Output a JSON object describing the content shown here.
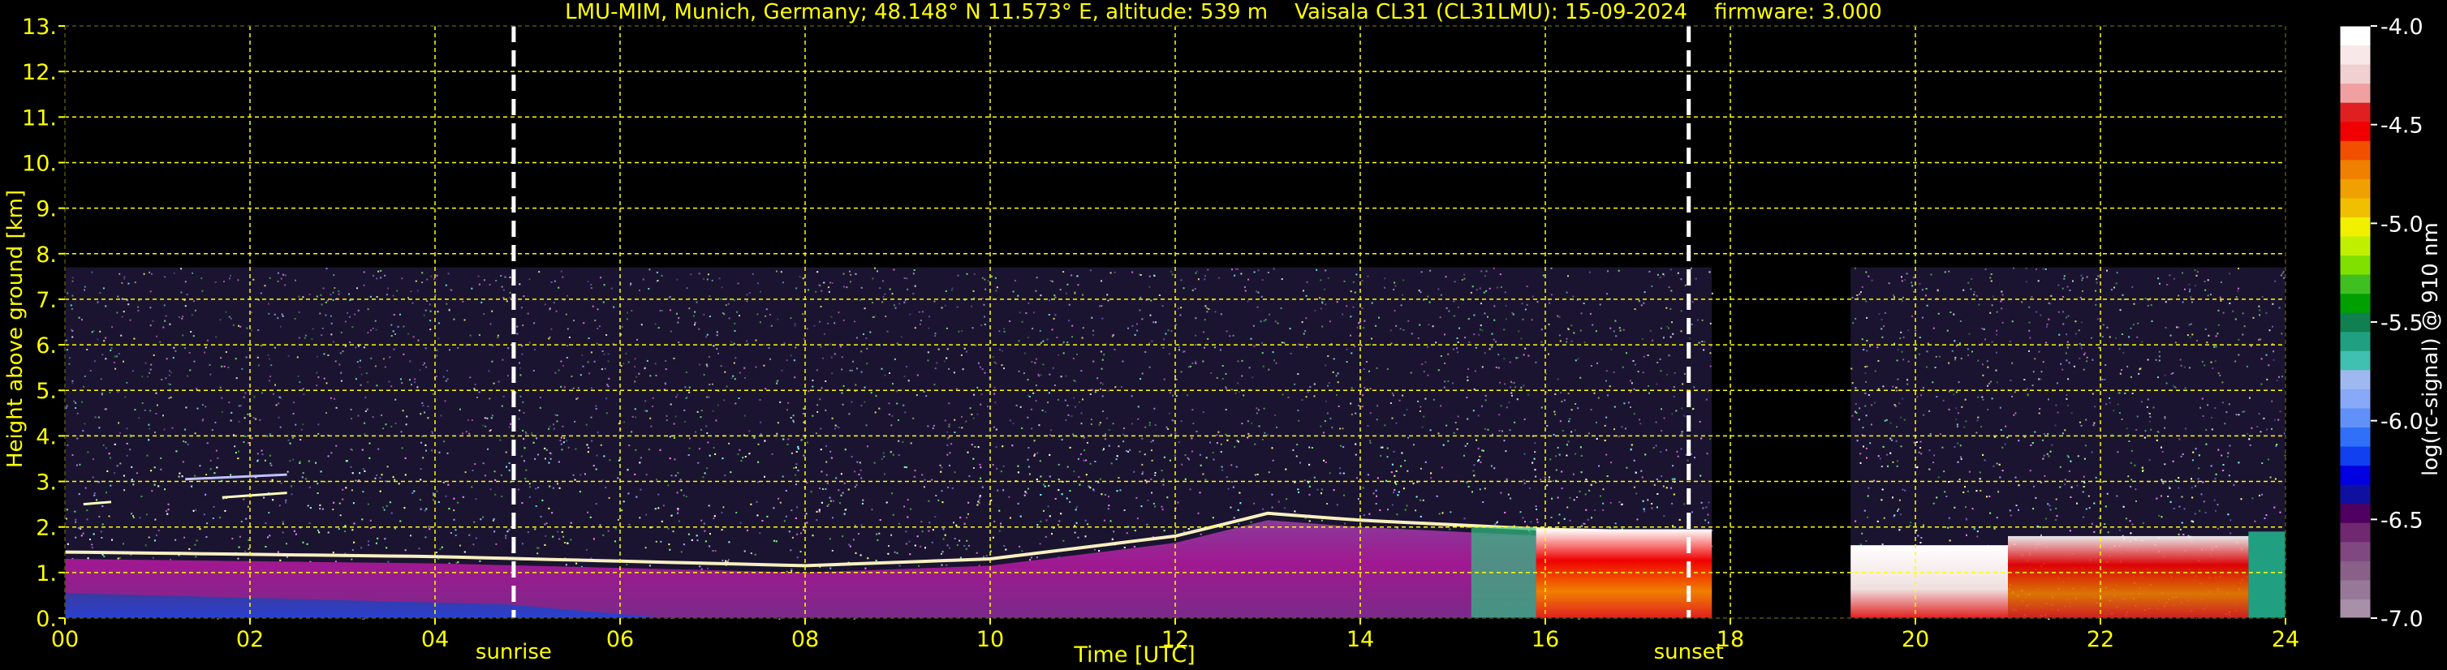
{
  "title": "LMU-MIM, Munich, Germany; 48.148° N 11.573° E, altitude: 539 m    Vaisala CL31 (CL31LMU): 15-09-2024    firmware: 3.000",
  "colors": {
    "axis_text": "#ffff00",
    "grid": "#ffff00",
    "marker_line": "#ffffff",
    "background": "#000000"
  },
  "chart_data": {
    "type": "heatmap",
    "xlabel": "Time [UTC]",
    "ylabel": "Height above ground [km]",
    "xlim": [
      0,
      24
    ],
    "ylim": [
      0,
      13
    ],
    "x_ticks": [
      "00",
      "02",
      "04",
      "06",
      "08",
      "10",
      "12",
      "14",
      "16",
      "18",
      "20",
      "22",
      "24"
    ],
    "y_ticks": [
      "0.",
      "1.",
      "2.",
      "3.",
      "4.",
      "5.",
      "6.",
      "7.",
      "8.",
      "9.",
      "10.",
      "11.",
      "12.",
      "13."
    ],
    "grid": true,
    "annotations": [
      {
        "label": "sunrise",
        "time_h": 4.85
      },
      {
        "label": "sunset",
        "time_h": 17.55
      }
    ],
    "data_gaps_h": [
      [
        17.8,
        19.3
      ]
    ],
    "max_signal_height_km": 7.7,
    "boundary_layer_top_km": [
      [
        0,
        1.45
      ],
      [
        2,
        1.4
      ],
      [
        4,
        1.35
      ],
      [
        6,
        1.25
      ],
      [
        8,
        1.15
      ],
      [
        10,
        1.3
      ],
      [
        12,
        1.8
      ],
      [
        13,
        2.3
      ],
      [
        14,
        2.15
      ],
      [
        15,
        2.05
      ],
      [
        16,
        1.95
      ],
      [
        17,
        1.9
      ],
      [
        17.8,
        1.7
      ]
    ],
    "colorbar": {
      "label": "log(rc-signal) @ 910 nm",
      "range": [
        -7.0,
        -4.0
      ],
      "ticks": [
        "-4.0",
        "-4.5",
        "-5.0",
        "-5.5",
        "-6.0",
        "-6.5",
        "-7.0"
      ],
      "colors": [
        "#a890a8",
        "#987898",
        "#886088",
        "#804880",
        "#702870",
        "#500060",
        "#1010a0",
        "#0000e0",
        "#1040f0",
        "#3070f8",
        "#6090f8",
        "#88a8f8",
        "#a0b8f0",
        "#40c0b0",
        "#20a080",
        "#108050",
        "#00a000",
        "#40c020",
        "#80e000",
        "#c0f000",
        "#f0f000",
        "#f0c000",
        "#f0a000",
        "#f08000",
        "#f05000",
        "#f00000",
        "#e02020",
        "#f0a0a0",
        "#f0d0d0",
        "#f8e8e8",
        "#ffffff"
      ]
    }
  }
}
